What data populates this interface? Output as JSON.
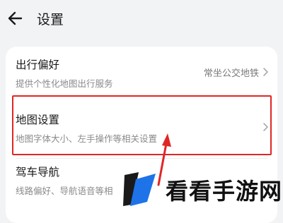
{
  "header": {
    "title": "设置"
  },
  "settings": [
    {
      "label": "出行偏好",
      "sub": "提供个性化地图出行服务",
      "value": "常坐公交地铁"
    },
    {
      "label": "地图设置",
      "sub": "地图字体大小、左手操作等相关设置"
    },
    {
      "label": "驾车导航",
      "sub": "线路偏好、导航语音等相"
    }
  ],
  "watermark": {
    "text": "看看手游网"
  },
  "colors": {
    "highlight": "#e02626",
    "background": "#f2f3f5",
    "card": "#ffffff"
  }
}
